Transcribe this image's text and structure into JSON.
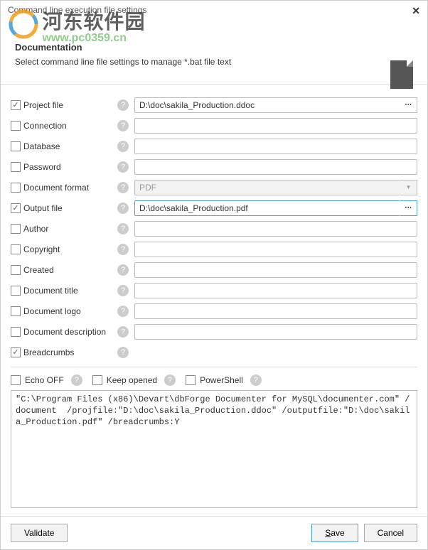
{
  "window": {
    "title": "Command line execution file settings"
  },
  "watermark": {
    "cn": "河东软件园",
    "url": "www.pc0359.cn"
  },
  "header": {
    "title": "Documentation",
    "subtitle": "Select command line file settings to manage *.bat file text"
  },
  "fields": {
    "project_file": {
      "label": "Project file",
      "value": "D:\\doc\\sakila_Production.ddoc"
    },
    "connection": {
      "label": "Connection",
      "value": ""
    },
    "database": {
      "label": "Database",
      "value": ""
    },
    "password": {
      "label": "Password",
      "value": ""
    },
    "document_format": {
      "label": "Document format",
      "value": "PDF"
    },
    "output_file": {
      "label": "Output file",
      "value": "D:\\doc\\sakila_Production.pdf"
    },
    "author": {
      "label": "Author",
      "value": ""
    },
    "copyright": {
      "label": "Copyright",
      "value": ""
    },
    "created": {
      "label": "Created",
      "value": ""
    },
    "document_title": {
      "label": "Document title",
      "value": ""
    },
    "document_logo": {
      "label": "Document logo",
      "value": ""
    },
    "document_description": {
      "label": "Document description",
      "value": ""
    },
    "breadcrumbs": {
      "label": "Breadcrumbs"
    }
  },
  "options": {
    "echo_off": "Echo OFF",
    "keep_opened": "Keep opened",
    "powershell": "PowerShell"
  },
  "command_text": "\"C:\\Program Files (x86)\\Devart\\dbForge Documenter for MySQL\\documenter.com\" /document  /projfile:\"D:\\doc\\sakila_Production.ddoc\" /outputfile:\"D:\\doc\\sakila_Production.pdf\" /breadcrumbs:Y",
  "buttons": {
    "validate": "Validate",
    "save": "Save",
    "cancel": "Cancel"
  }
}
